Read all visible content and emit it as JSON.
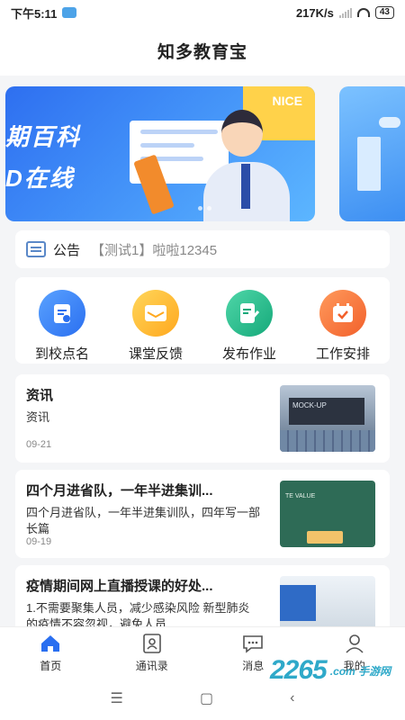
{
  "status_bar": {
    "time": "下午5:11",
    "speed": "217K/s",
    "battery": "43"
  },
  "header": {
    "title": "知多教育宝"
  },
  "banner": {
    "line1": "期百科",
    "line2": "D在线",
    "badge": "NICE"
  },
  "notice": {
    "label": "公告",
    "message": "【测试1】啦啦12345"
  },
  "actions": [
    {
      "label": "到校点名",
      "icon": "clipboard-check-icon",
      "color": "#2a6ff0"
    },
    {
      "label": "课堂反馈",
      "icon": "envelope-icon",
      "color": "#ffa81e"
    },
    {
      "label": "发布作业",
      "icon": "document-edit-icon",
      "color": "#15a97a"
    },
    {
      "label": "工作安排",
      "icon": "calendar-check-icon",
      "color": "#f2602b"
    }
  ],
  "news": [
    {
      "title": "资讯",
      "desc": "资讯",
      "date": "09-21",
      "thumb_text": "MOCK-UP"
    },
    {
      "title": "四个月进省队，一年半进集训...",
      "desc": "四个月进省队，一年半进集训队，四年写一部长篇",
      "date": "09-19",
      "thumb_text": "TE VALUE"
    },
    {
      "title": "疫情期间网上直播授课的好处...",
      "desc": "1.不需要聚集人员，减少感染风险 新型肺炎的疫情不容忽视，避免人员",
      "date": ""
    }
  ],
  "bottom_nav": [
    {
      "label": "首页",
      "icon": "home-icon",
      "active": true
    },
    {
      "label": "通讯录",
      "icon": "contacts-icon",
      "active": false
    },
    {
      "label": "消息",
      "icon": "message-icon",
      "active": false
    },
    {
      "label": "我的",
      "icon": "profile-icon",
      "active": false
    }
  ],
  "watermark": {
    "number": "2265",
    "brand": ".com 手游网"
  },
  "colors": {
    "accent": "#2a6ff0",
    "background": "#f4f5f7"
  }
}
